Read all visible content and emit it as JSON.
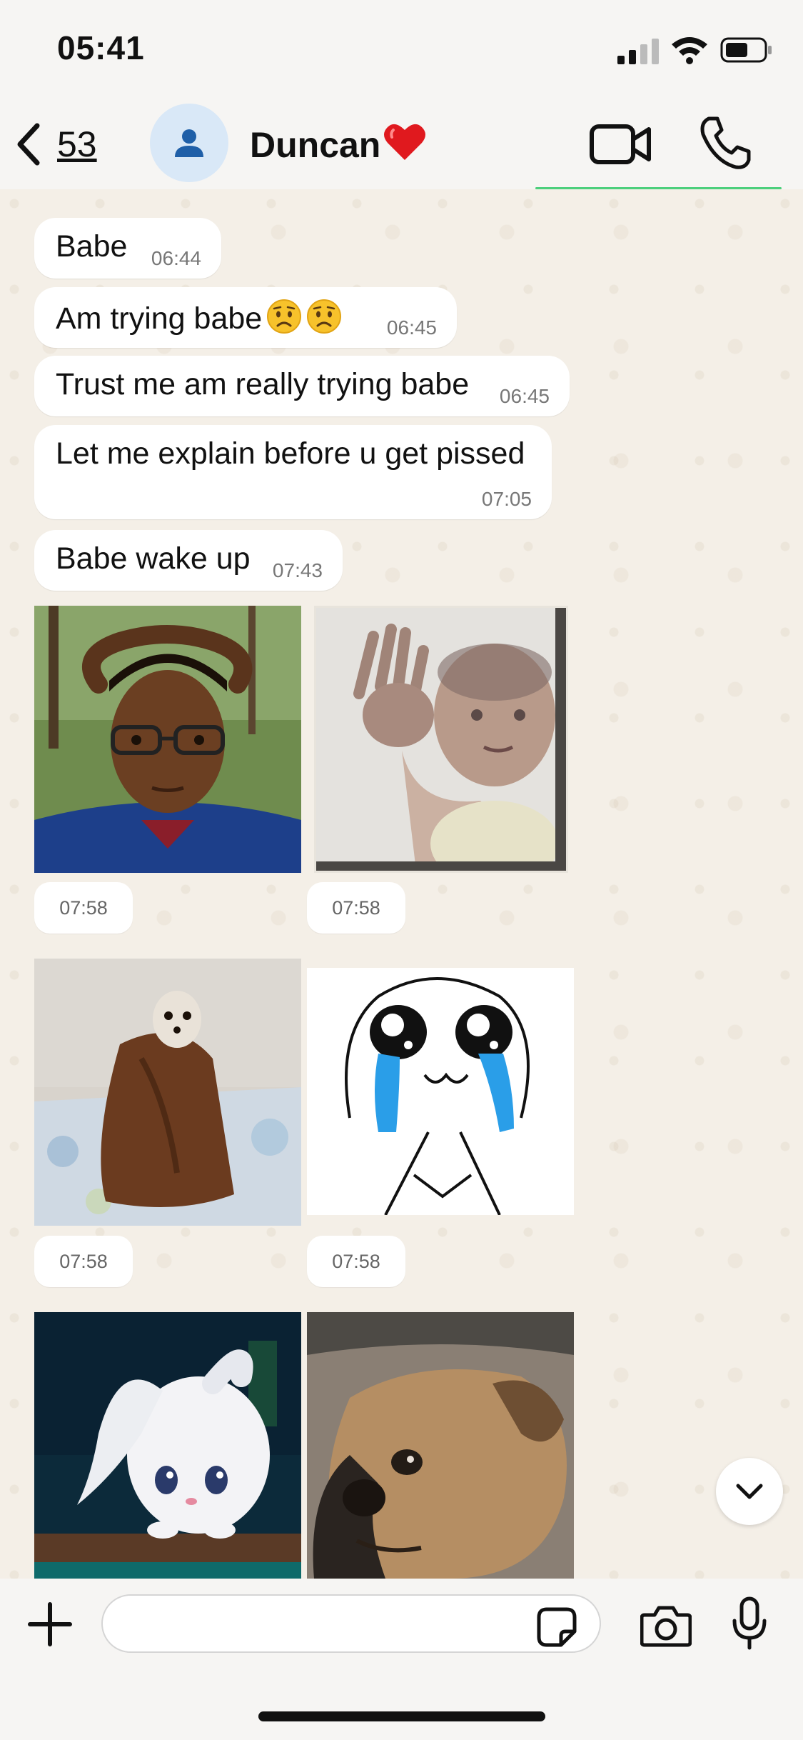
{
  "status_bar": {
    "time": "05:41"
  },
  "header": {
    "back_count": "53",
    "contact_name": "Duncan",
    "heart_icon": "red-heart-emoji"
  },
  "messages": [
    {
      "text": "Babe",
      "time": "06:44"
    },
    {
      "text": "Am trying babe",
      "emoji": "worried-face x2",
      "time": "06:45"
    },
    {
      "text": "Trust me am really trying babe",
      "time": "06:45"
    },
    {
      "text": "Let me explain before u get pissed",
      "time": "07:05"
    },
    {
      "text": "Babe wake up",
      "time": "07:43"
    }
  ],
  "media": [
    {
      "name": "boy-hands-on-head-photo",
      "time": "07:58"
    },
    {
      "name": "baby-behind-frosted-glass-photo",
      "time": "07:58"
    },
    {
      "name": "dog-wrapped-in-towel-photo",
      "time": "07:58"
    },
    {
      "name": "crying-cartoon-face-drawing",
      "time": "07:58"
    },
    {
      "name": "white-bunny-photo"
    },
    {
      "name": "sad-dog-photo"
    }
  ],
  "input": {
    "placeholder": ""
  },
  "colors": {
    "bubble": "#ffffff",
    "chat_bg": "#f4efe7",
    "accent_green": "#4ccf7c",
    "avatar_bg": "#d9e8f7",
    "avatar_fg": "#1f5fa8",
    "heart": "#e0191e"
  }
}
